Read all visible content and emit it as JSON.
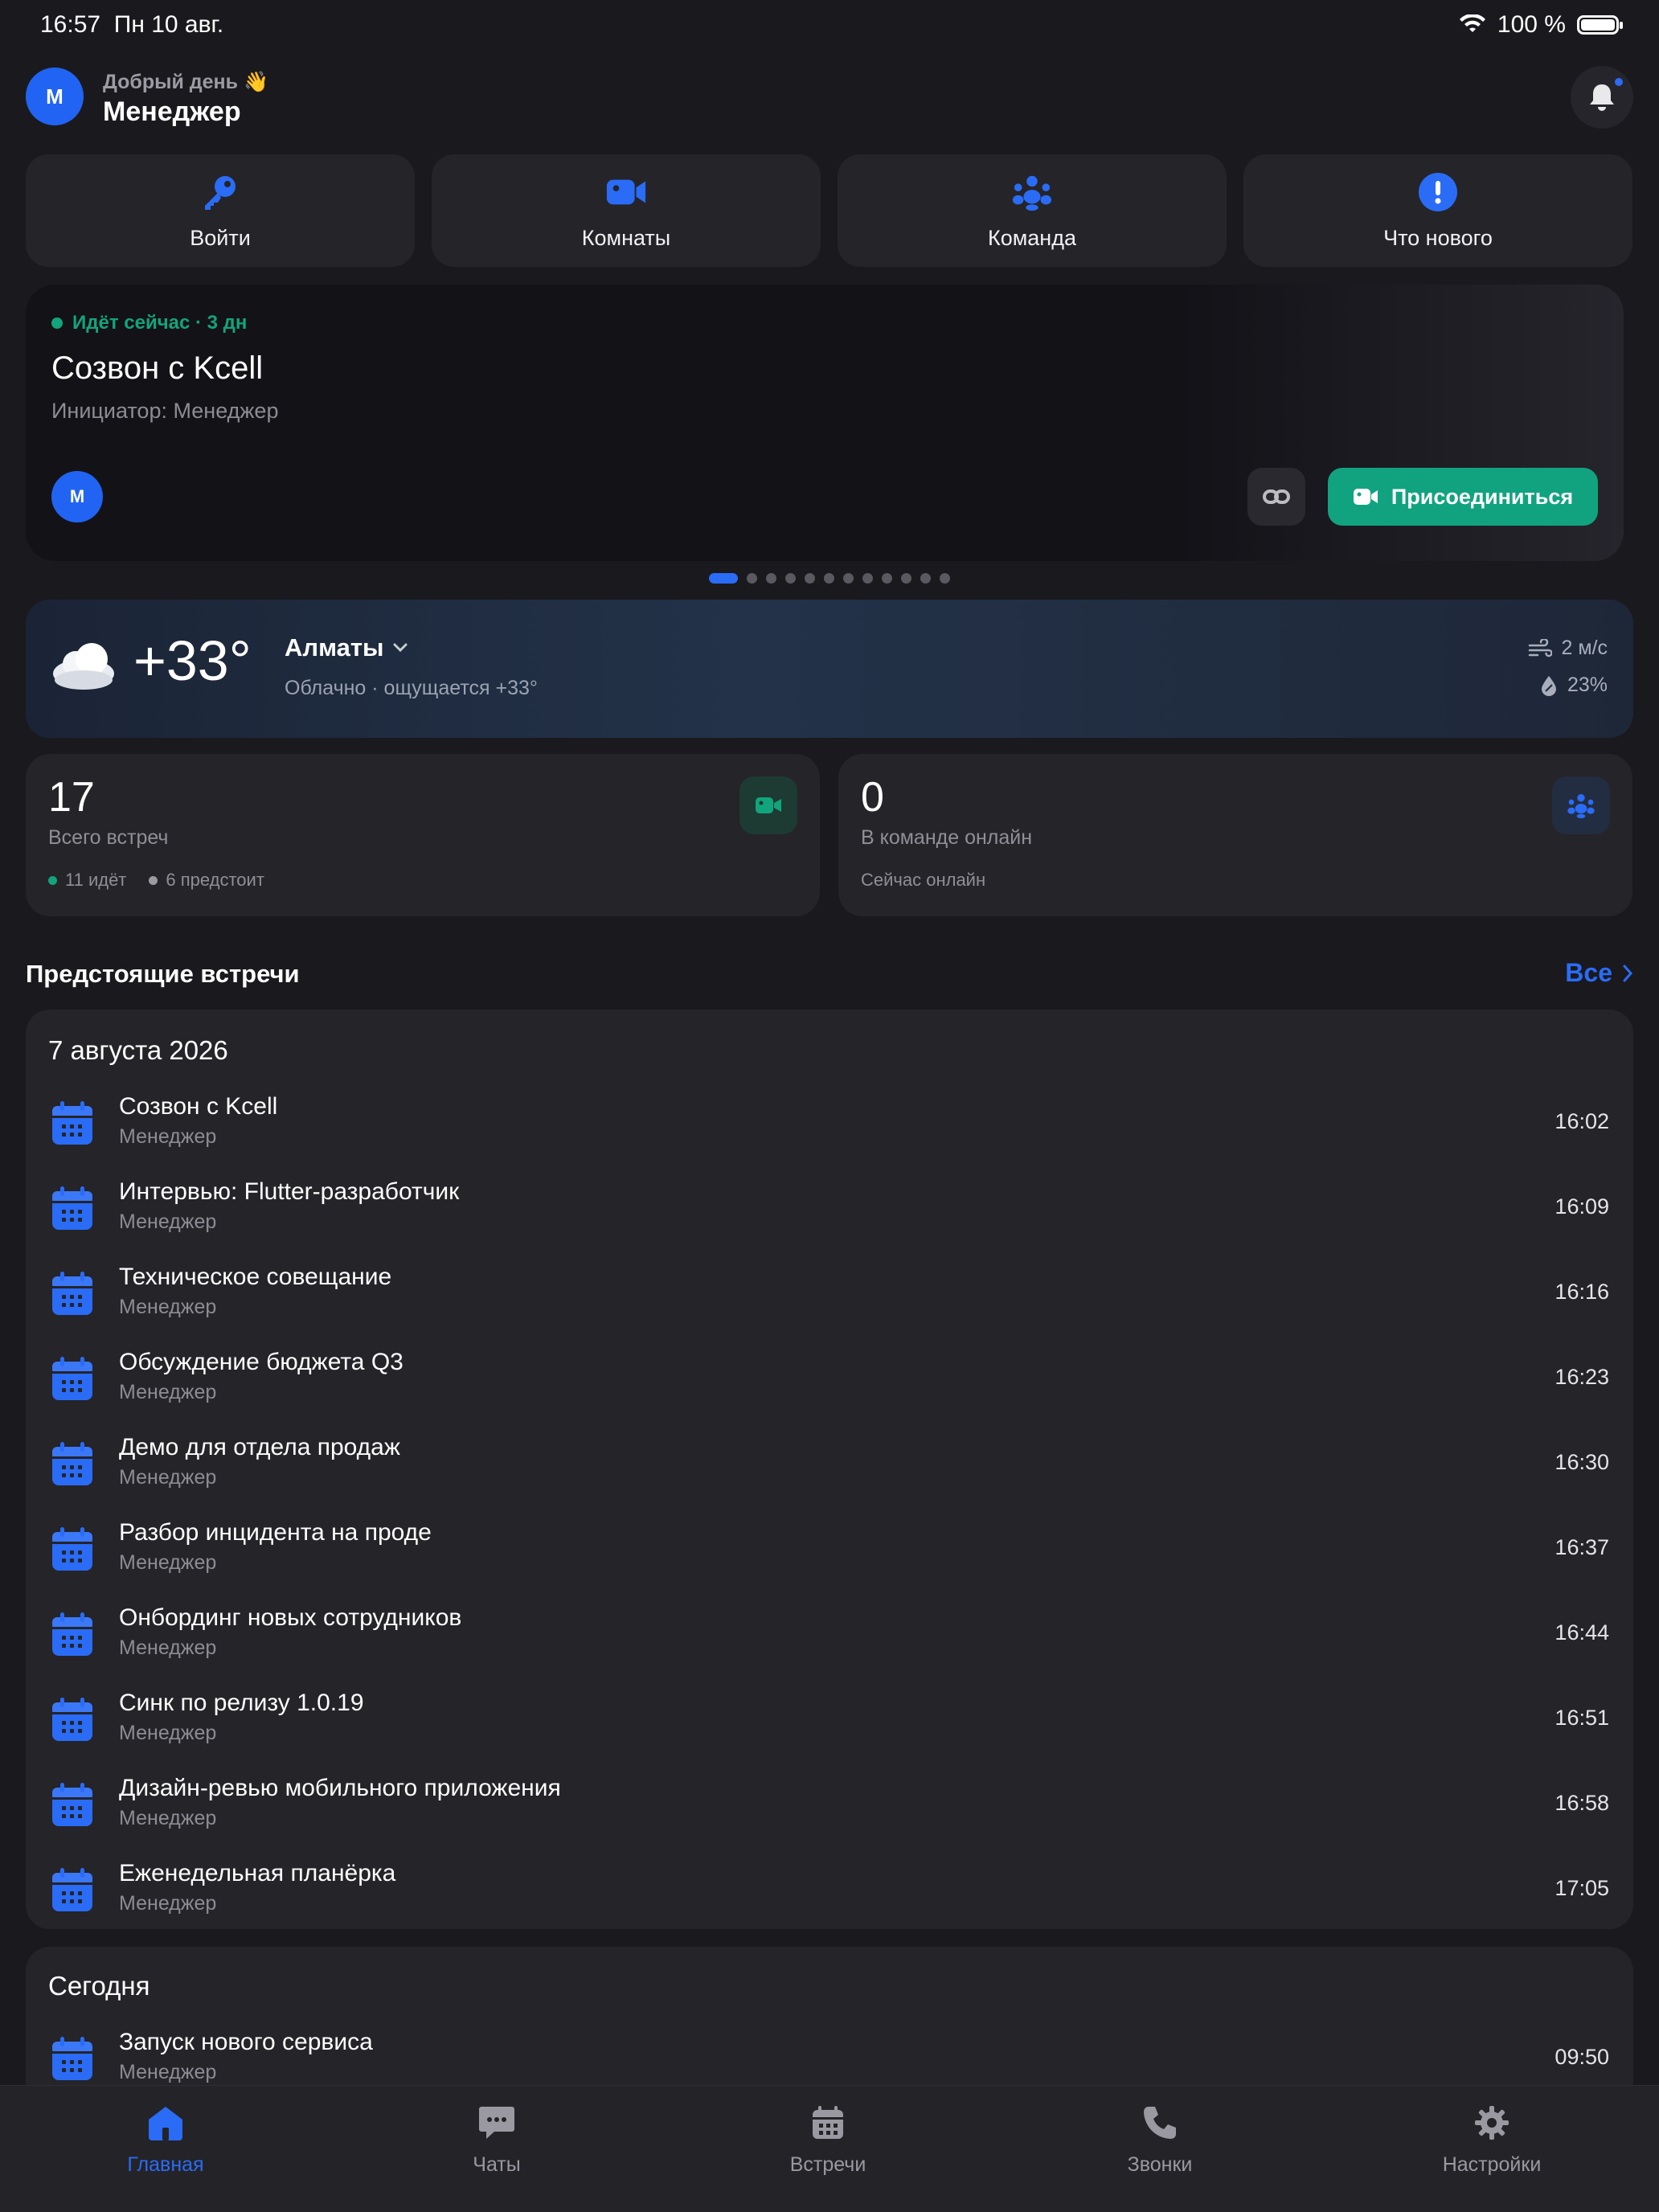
{
  "status": {
    "time": "16:57",
    "date": "Пн 10 авг.",
    "battery": "100 %"
  },
  "header": {
    "avatar_initial": "М",
    "greeting": "Добрый день 👋",
    "username": "Менеджер"
  },
  "quick_actions": [
    {
      "label": "Войти",
      "icon": "key-icon"
    },
    {
      "label": "Комнаты",
      "icon": "video-camera-icon"
    },
    {
      "label": "Команда",
      "icon": "team-icon"
    },
    {
      "label": "Что нового",
      "icon": "exclamation-icon"
    }
  ],
  "active_meeting": {
    "status": "Идёт сейчас · 3 дн",
    "title": "Созвон с Kcell",
    "initiator": "Инициатор: Менеджер",
    "avatar_initial": "М",
    "join_label": "Присоединиться"
  },
  "pager": {
    "count": 12,
    "active_index": 0
  },
  "weather": {
    "temp": "+33°",
    "city": "Алматы",
    "condition": "Облачно · ощущается +33°",
    "wind": "2 м/с",
    "humidity": "23%"
  },
  "stats": {
    "meetings": {
      "value": "17",
      "label": "Всего встреч",
      "ongoing": "11 идёт",
      "upcoming": "6 предстоит"
    },
    "team": {
      "value": "0",
      "label": "В команде онлайн",
      "meta": "Сейчас онлайн"
    }
  },
  "upcoming": {
    "title": "Предстоящие встречи",
    "see_all": "Все",
    "groups": [
      {
        "date": "7 августа 2026",
        "items": [
          {
            "title": "Созвон с Kcell",
            "sub": "Менеджер",
            "time": "16:02"
          },
          {
            "title": "Интервью: Flutter-разработчик",
            "sub": "Менеджер",
            "time": "16:09"
          },
          {
            "title": "Техническое совещание",
            "sub": "Менеджер",
            "time": "16:16"
          },
          {
            "title": "Обсуждение бюджета Q3",
            "sub": "Менеджер",
            "time": "16:23"
          },
          {
            "title": "Демо для отдела продаж",
            "sub": "Менеджер",
            "time": "16:30"
          },
          {
            "title": "Разбор инцидента на проде",
            "sub": "Менеджер",
            "time": "16:37"
          },
          {
            "title": "Онбординг новых сотрудников",
            "sub": "Менеджер",
            "time": "16:44"
          },
          {
            "title": "Синк по релизу 1.0.19",
            "sub": "Менеджер",
            "time": "16:51"
          },
          {
            "title": "Дизайн-ревью мобильного приложения",
            "sub": "Менеджер",
            "time": "16:58"
          },
          {
            "title": "Еженедельная планёрка",
            "sub": "Менеджер",
            "time": "17:05"
          }
        ]
      },
      {
        "date": "Сегодня",
        "items": [
          {
            "title": "Запуск нового сервиса",
            "sub": "Менеджер",
            "time": "09:50"
          }
        ]
      }
    ]
  },
  "nav": [
    {
      "label": "Главная",
      "icon": "home-icon",
      "active": true
    },
    {
      "label": "Чаты",
      "icon": "chat-icon",
      "active": false
    },
    {
      "label": "Встречи",
      "icon": "calendar-icon",
      "active": false
    },
    {
      "label": "Звонки",
      "icon": "phone-icon",
      "active": false
    },
    {
      "label": "Настройки",
      "icon": "gear-icon",
      "active": false
    }
  ],
  "colors": {
    "accent": "#2a6cf6",
    "success": "#12a47c",
    "background": "#1a191e",
    "card": "#252429"
  }
}
